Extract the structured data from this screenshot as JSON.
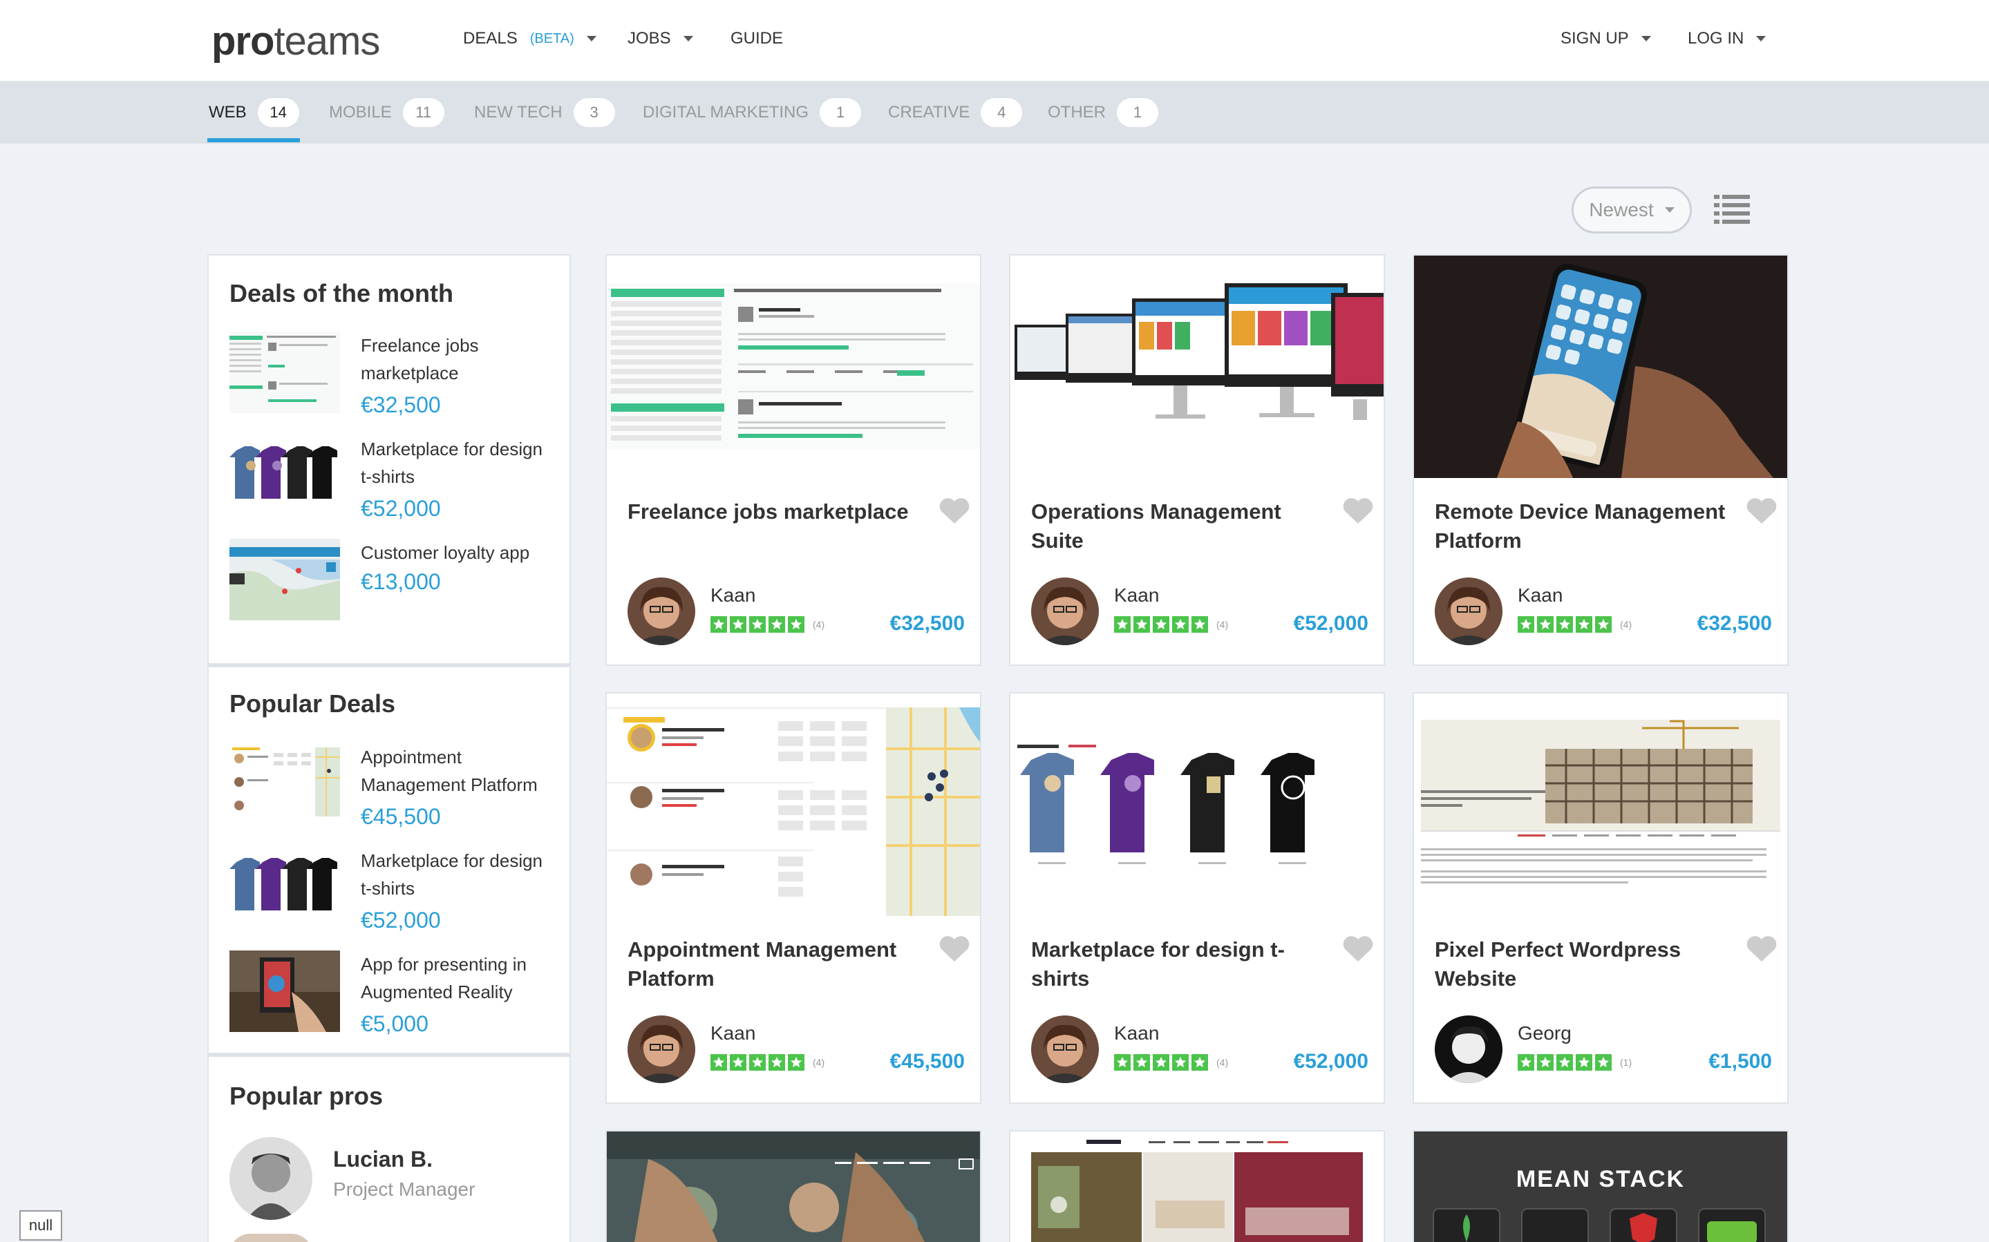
{
  "header": {
    "logo_bold": "pro",
    "logo_light": "teams",
    "nav": {
      "deals": "DEALS",
      "beta": "(BETA)",
      "jobs": "JOBS",
      "guide": "GUIDE",
      "signup": "SIGN UP",
      "login": "LOG IN"
    }
  },
  "categories": [
    {
      "label": "WEB",
      "count": "14"
    },
    {
      "label": "MOBILE",
      "count": "11"
    },
    {
      "label": "NEW TECH",
      "count": "3"
    },
    {
      "label": "DIGITAL MARKETING",
      "count": "1"
    },
    {
      "label": "CREATIVE",
      "count": "4"
    },
    {
      "label": "OTHER",
      "count": "1"
    }
  ],
  "sort": {
    "label": "Newest",
    "view_icon": "list-view-icon"
  },
  "sidebar": {
    "deals_of_month": {
      "title": "Deals of the month",
      "items": [
        {
          "title": "Freelance jobs marketplace",
          "price": "€32,500"
        },
        {
          "title": "Marketplace for design t-shirts",
          "price": "€52,000"
        },
        {
          "title": "Customer loyalty app",
          "price": "€13,000"
        }
      ]
    },
    "popular_deals": {
      "title": "Popular Deals",
      "items": [
        {
          "title": "Appointment Management Platform",
          "price": "€45,500"
        },
        {
          "title": "Marketplace for design t-shirts",
          "price": "€52,000"
        },
        {
          "title": "App for presenting in Augmented Reality",
          "price": "€5,000"
        }
      ]
    },
    "popular_pros": {
      "title": "Popular pros",
      "items": [
        {
          "name": "Lucian B.",
          "role": "Project Manager"
        }
      ]
    }
  },
  "cards": [
    {
      "title": "Freelance jobs marketplace",
      "user": "Kaan",
      "reviews": "(4)",
      "price": "€32,500"
    },
    {
      "title": "Operations Management Suite",
      "user": "Kaan",
      "reviews": "(4)",
      "price": "€52,000"
    },
    {
      "title": "Remote Device Management Platform",
      "user": "Kaan",
      "reviews": "(4)",
      "price": "€32,500"
    },
    {
      "title": "Appointment Management Platform",
      "user": "Kaan",
      "reviews": "(4)",
      "price": "€45,500"
    },
    {
      "title": "Marketplace for design t-shirts",
      "user": "Kaan",
      "reviews": "(4)",
      "price": "€52,000"
    },
    {
      "title": "Pixel Perfect Wordpress Website",
      "user": "Georg",
      "reviews": "(1)",
      "price": "€1,500"
    }
  ],
  "bottom_cards": {
    "card3_text": "MEAN STACK"
  },
  "null_badge": "null",
  "colors": {
    "accent": "#2a9fd8",
    "star": "#4cc44c"
  }
}
